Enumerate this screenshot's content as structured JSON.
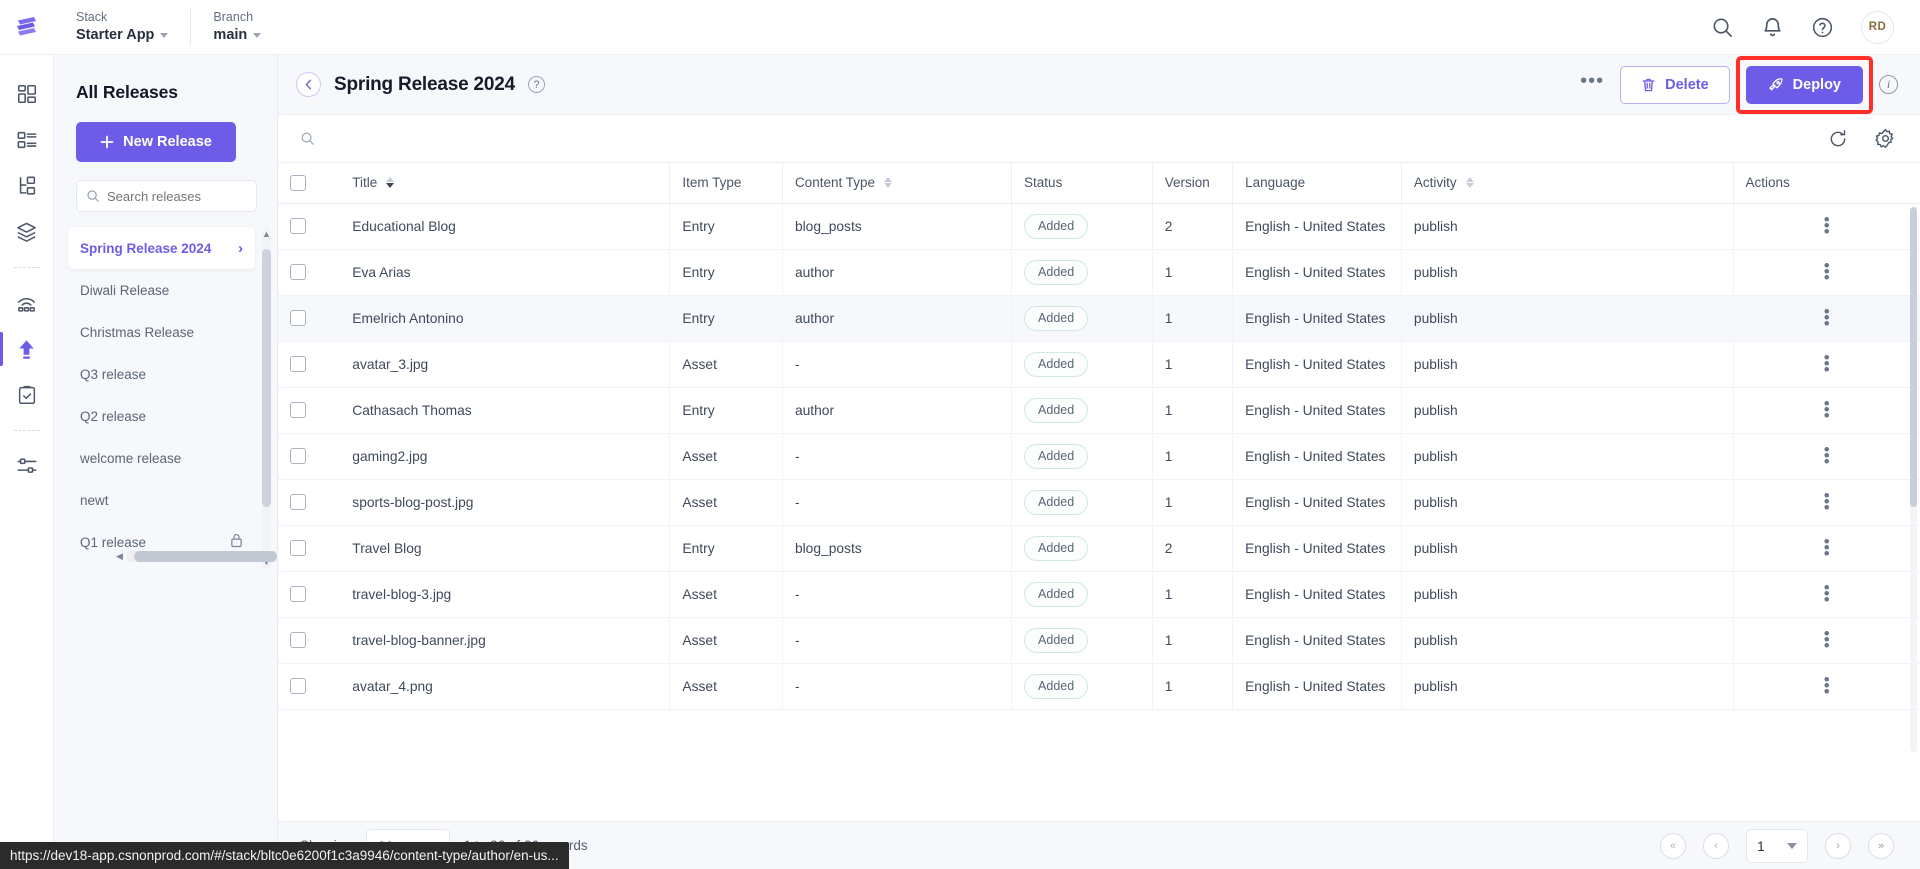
{
  "topbar": {
    "logo_icon": "contentstack-logo-icon",
    "context": [
      {
        "label": "Stack",
        "value": "Starter App"
      },
      {
        "label": "Branch",
        "value": "main"
      }
    ],
    "actions": [
      {
        "icon": "search-icon",
        "name": "global-search"
      },
      {
        "icon": "bell-icon",
        "name": "notifications"
      },
      {
        "icon": "help-circle-icon",
        "name": "help"
      }
    ],
    "avatar_initials": "RD"
  },
  "rail": {
    "items": [
      {
        "icon": "dashboard-icon",
        "name": "sidebar-rail-dashboard",
        "active": false
      },
      {
        "icon": "content-types-icon",
        "name": "sidebar-rail-content-types",
        "active": false
      },
      {
        "icon": "entries-tree-icon",
        "name": "sidebar-rail-entries",
        "active": false
      },
      {
        "icon": "layers-icon",
        "name": "sidebar-rail-assets",
        "active": false
      },
      {
        "icon": "divider",
        "name": "sidebar-rail-divider-1",
        "active": false
      },
      {
        "icon": "live-preview-icon",
        "name": "sidebar-rail-live-preview",
        "active": false
      },
      {
        "icon": "upload-arrow-icon",
        "name": "sidebar-rail-releases",
        "active": true
      },
      {
        "icon": "clipboard-check-icon",
        "name": "sidebar-rail-workflow",
        "active": false
      },
      {
        "icon": "divider",
        "name": "sidebar-rail-divider-2",
        "active": false
      },
      {
        "icon": "sliders-icon",
        "name": "sidebar-rail-settings",
        "active": false
      }
    ]
  },
  "releases_sidebar": {
    "title": "All Releases",
    "new_release_label": "New Release",
    "search_placeholder": "Search releases",
    "search_value": "",
    "items": [
      {
        "label": "Spring Release 2024",
        "selected": true,
        "locked": false
      },
      {
        "label": "Diwali Release",
        "selected": false,
        "locked": false
      },
      {
        "label": "Christmas Release",
        "selected": false,
        "locked": false
      },
      {
        "label": "Q3 release",
        "selected": false,
        "locked": false
      },
      {
        "label": "Q2 release",
        "selected": false,
        "locked": false
      },
      {
        "label": "welcome release",
        "selected": false,
        "locked": false
      },
      {
        "label": "newt",
        "selected": false,
        "locked": false
      },
      {
        "label": "Q1 release",
        "selected": false,
        "locked": true
      }
    ]
  },
  "header": {
    "back_icon": "chevron-left-circle-icon",
    "title": "Spring Release 2024",
    "help_icon": "question-mark-icon",
    "more_label": "•••",
    "delete_label": "Delete",
    "deploy_label": "Deploy",
    "info_icon": "info-circle-icon",
    "highlight_color": "#fe2f28"
  },
  "toolbar": {
    "search_placeholder": "",
    "search_value": "",
    "refresh_icon": "refresh-icon",
    "settings_icon": "gear-icon"
  },
  "table": {
    "columns": [
      {
        "key": "checkbox",
        "label": "",
        "sortable": false
      },
      {
        "key": "title",
        "label": "Title",
        "sortable": true,
        "sort": "desc"
      },
      {
        "key": "item_type",
        "label": "Item Type",
        "sortable": false
      },
      {
        "key": "content_type",
        "label": "Content Type",
        "sortable": true,
        "sort": "none"
      },
      {
        "key": "status",
        "label": "Status",
        "sortable": false
      },
      {
        "key": "version",
        "label": "Version",
        "sortable": false
      },
      {
        "key": "language",
        "label": "Language",
        "sortable": false
      },
      {
        "key": "activity",
        "label": "Activity",
        "sortable": true,
        "sort": "none"
      },
      {
        "key": "actions",
        "label": "Actions",
        "sortable": false
      }
    ],
    "rows": [
      {
        "title": "Educational Blog",
        "item_type": "Entry",
        "content_type": "blog_posts",
        "status": "Added",
        "version": "2",
        "language": "English - United States",
        "activity": "publish",
        "hovered": false
      },
      {
        "title": "Eva Arias",
        "item_type": "Entry",
        "content_type": "author",
        "status": "Added",
        "version": "1",
        "language": "English - United States",
        "activity": "publish",
        "hovered": false
      },
      {
        "title": "Emelrich Antonino",
        "item_type": "Entry",
        "content_type": "author",
        "status": "Added",
        "version": "1",
        "language": "English - United States",
        "activity": "publish",
        "hovered": true
      },
      {
        "title": "avatar_3.jpg",
        "item_type": "Asset",
        "content_type": "-",
        "status": "Added",
        "version": "1",
        "language": "English - United States",
        "activity": "publish",
        "hovered": false
      },
      {
        "title": "Cathasach Thomas",
        "item_type": "Entry",
        "content_type": "author",
        "status": "Added",
        "version": "1",
        "language": "English - United States",
        "activity": "publish",
        "hovered": false
      },
      {
        "title": "gaming2.jpg",
        "item_type": "Asset",
        "content_type": "-",
        "status": "Added",
        "version": "1",
        "language": "English - United States",
        "activity": "publish",
        "hovered": false
      },
      {
        "title": "sports-blog-post.jpg",
        "item_type": "Asset",
        "content_type": "-",
        "status": "Added",
        "version": "1",
        "language": "English - United States",
        "activity": "publish",
        "hovered": false
      },
      {
        "title": "Travel Blog",
        "item_type": "Entry",
        "content_type": "blog_posts",
        "status": "Added",
        "version": "2",
        "language": "English - United States",
        "activity": "publish",
        "hovered": false
      },
      {
        "title": "travel-blog-3.jpg",
        "item_type": "Asset",
        "content_type": "-",
        "status": "Added",
        "version": "1",
        "language": "English - United States",
        "activity": "publish",
        "hovered": false
      },
      {
        "title": "travel-blog-banner.jpg",
        "item_type": "Asset",
        "content_type": "-",
        "status": "Added",
        "version": "1",
        "language": "English - United States",
        "activity": "publish",
        "hovered": false
      },
      {
        "title": "avatar_4.png",
        "item_type": "Asset",
        "content_type": "-",
        "status": "Added",
        "version": "1",
        "language": "English - United States",
        "activity": "publish",
        "hovered": false
      }
    ]
  },
  "footer": {
    "showing_label": "Showing",
    "page_size": "20",
    "records_label": "1 to 26 of 26 records",
    "current_page": "1",
    "first_icon": "double-chevron-left-icon",
    "prev_icon": "chevron-left-icon",
    "next_icon": "chevron-right-icon",
    "last_icon": "double-chevron-right-icon"
  },
  "status_bar": {
    "url": "https://dev18-app.csnonprod.com/#/stack/bltc0e6200f1c3a9946/content-type/author/en-us..."
  }
}
